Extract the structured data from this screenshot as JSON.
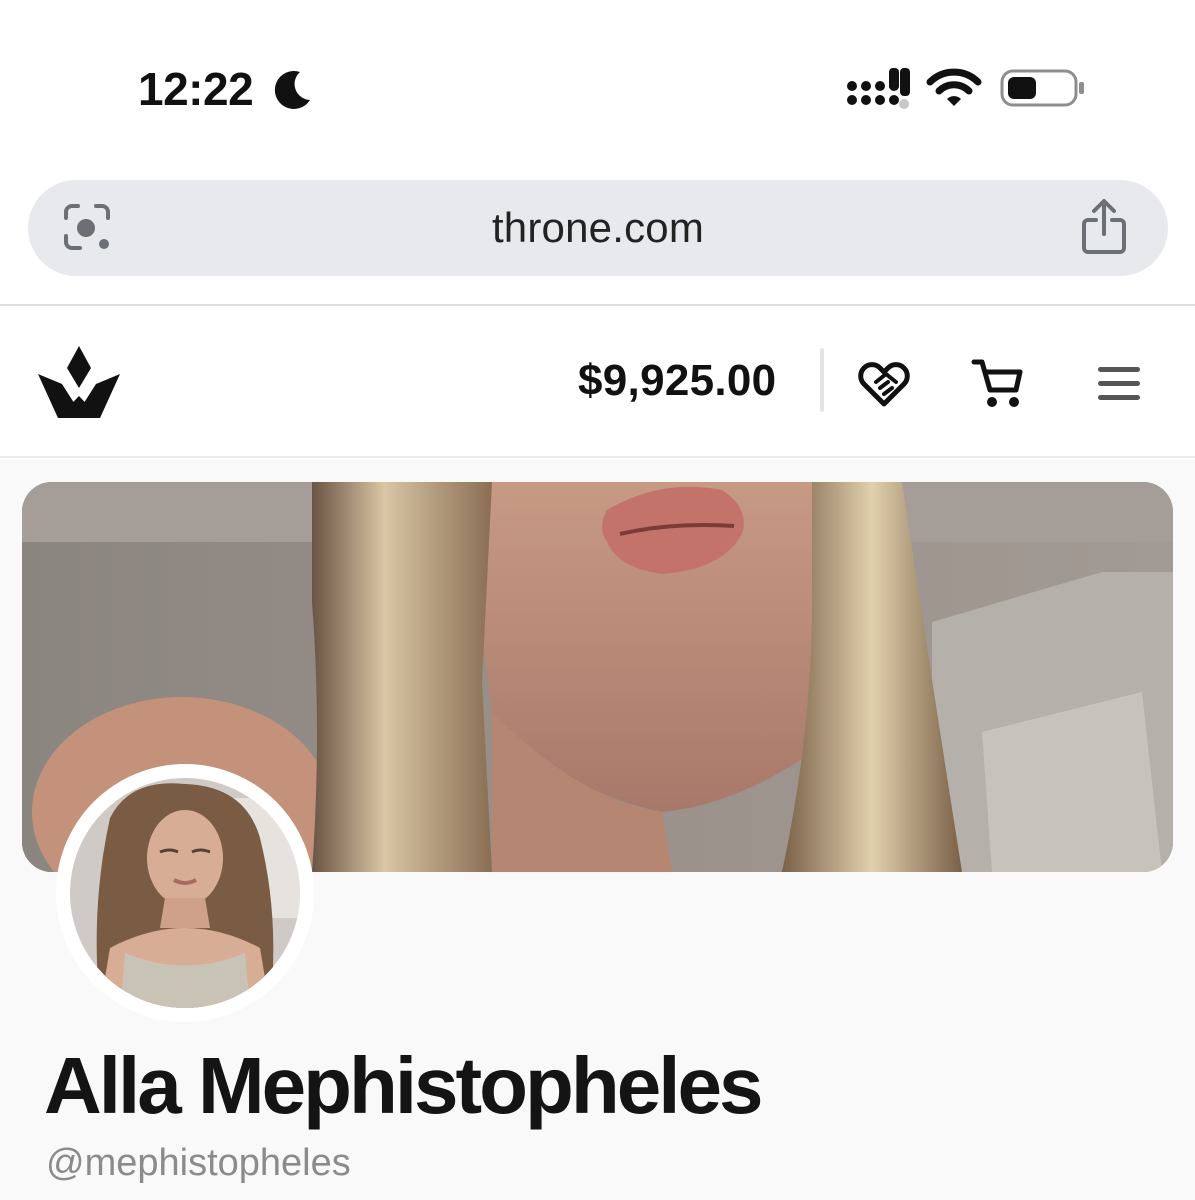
{
  "status_bar": {
    "time": "12:22",
    "focus_icon": "moon-icon",
    "signal_icon": "cellular-signal-icon",
    "wifi_icon": "wifi-icon",
    "battery_icon": "battery-icon",
    "battery_level": 0.4
  },
  "browser": {
    "url": "throne.com",
    "left_icon": "visual-lookup-icon",
    "right_icon": "share-icon"
  },
  "site_header": {
    "logo": "throne-crown-logo",
    "balance": "$9,925.00",
    "icons": [
      "heart-handshake-icon",
      "cart-icon",
      "menu-icon"
    ]
  },
  "profile": {
    "name": "Alla Mephistopheles",
    "username": "@mephistopheles",
    "cover_image": "cover-photo",
    "avatar_image": "avatar-photo"
  },
  "colors": {
    "text_primary": "#111111",
    "text_secondary": "#8b8b8b",
    "address_bar_bg": "#e8e9ec",
    "page_bg": "#f9f9f9"
  }
}
